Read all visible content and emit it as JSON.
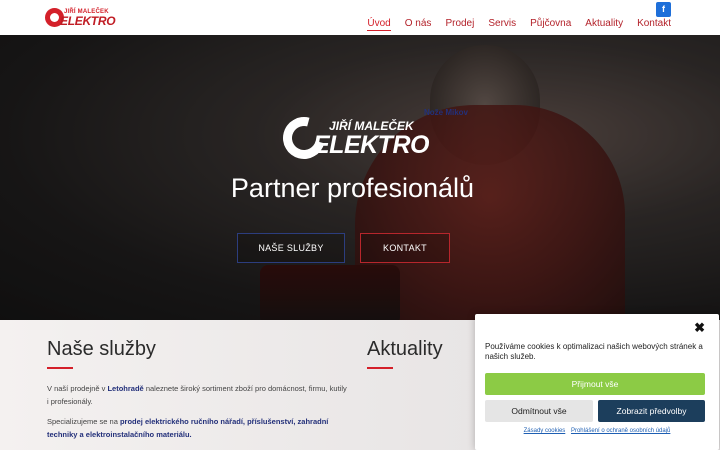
{
  "header": {
    "logo_name": "JIŘÍ MALEČEK",
    "logo_brand": "ELEKTRO",
    "nav": [
      "Úvod",
      "O nás",
      "Prodej",
      "Servis",
      "Půjčovna",
      "Aktuality",
      "Kontakt"
    ],
    "facebook_icon": "facebook-icon",
    "facebook_glyph": "f"
  },
  "hero": {
    "logo_name": "JIŘÍ MALEČEK",
    "logo_brand": "ELEKTRO",
    "tagline": "Partner profesionálů",
    "btn_services": "NAŠE SLUŽBY",
    "btn_contact": "KONTAKT"
  },
  "services": {
    "title": "Naše služby",
    "p1_before": "V naší prodejně v ",
    "p1_bold": "Letohradě",
    "p1_after": " naleznete široký sortiment zboží pro domácnost, firmu, kutily i profesionály.",
    "p2_before": "Specializujeme se na ",
    "p2_bold": "prodej elektrického ručního nářadí, příslušenství, zahradní techniky a elektroinstalačního materiálu."
  },
  "news": {
    "title": "Aktuality",
    "item": "Nože Mikov"
  },
  "cookie": {
    "message": "Používáme cookies k optimalizaci našich webových stránek a našich služeb.",
    "accept": "Přijmout vše",
    "deny": "Odmítnout vše",
    "prefs": "Zobrazit předvolby",
    "link1": "Zásady cookies",
    "link2": "Prohlášení o ochraně osobních údajů",
    "close_glyph": "✖"
  },
  "colors": {
    "accent_red": "#d4202a",
    "navy": "#23307a",
    "accept_green": "#8ccb45",
    "prefs_blue": "#1c3e5c",
    "facebook_blue": "#1e6fd9"
  }
}
